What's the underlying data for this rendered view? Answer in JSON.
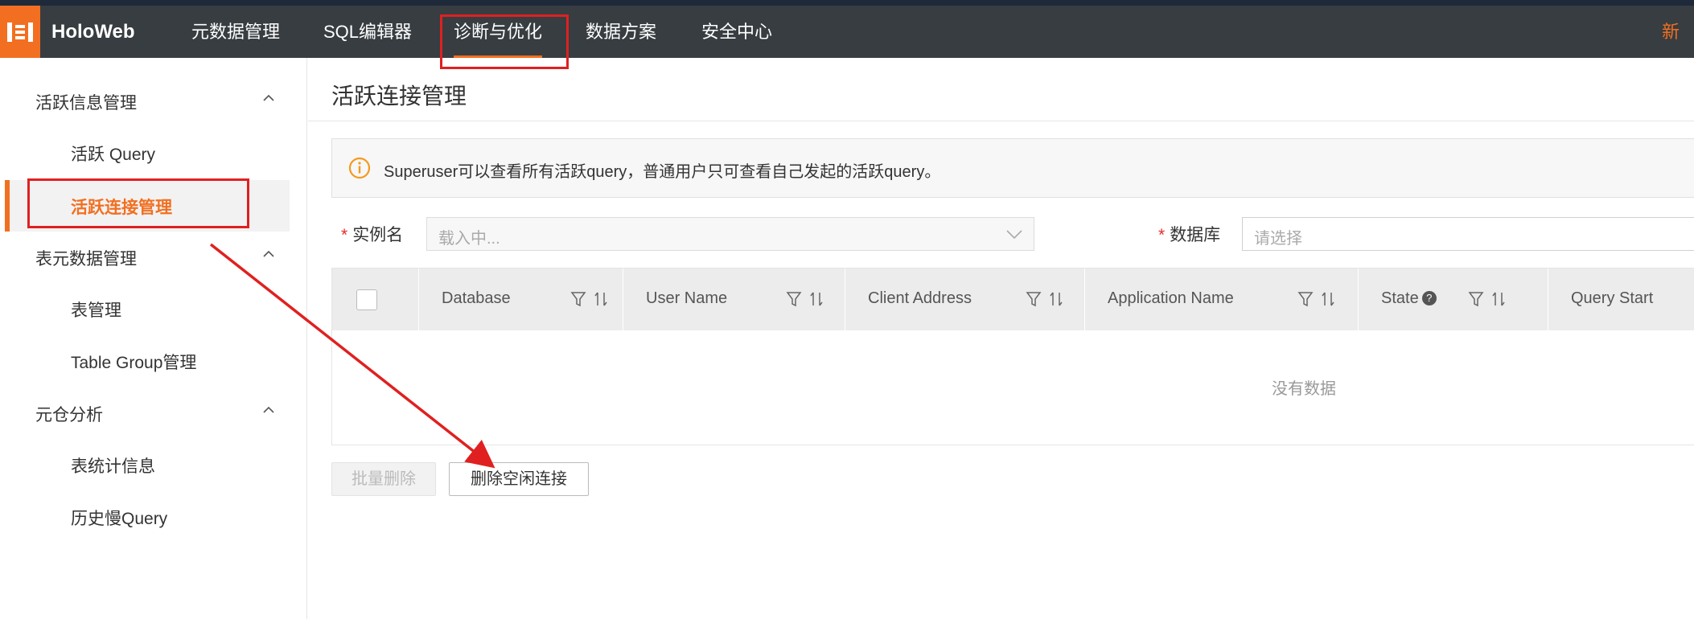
{
  "topbar": {
    "brand": "HoloWeb",
    "nav": [
      {
        "label": "元数据管理"
      },
      {
        "label": "SQL编辑器"
      },
      {
        "label": "诊断与优化"
      },
      {
        "label": "数据方案"
      },
      {
        "label": "安全中心"
      }
    ],
    "right_label": "新功"
  },
  "sidebar": {
    "groups": [
      {
        "label": "活跃信息管理",
        "items": [
          "活跃 Query",
          "活跃连接管理"
        ]
      },
      {
        "label": "表元数据管理",
        "items": [
          "表管理",
          "Table Group管理"
        ]
      },
      {
        "label": "元仓分析",
        "items": [
          "表统计信息",
          "历史慢Query"
        ]
      }
    ],
    "active_item": "活跃连接管理"
  },
  "main": {
    "title": "活跃连接管理",
    "notice": "Superuser可以查看所有活跃query，普通用户只可查看自己发起的活跃query。",
    "instance": {
      "label": "实例名",
      "required_mark": "*",
      "placeholder": "载入中..."
    },
    "database": {
      "label": "数据库",
      "required_mark": "*",
      "placeholder": "请选择"
    },
    "table": {
      "columns": [
        "Database",
        "User Name",
        "Client Address",
        "Application Name",
        "State",
        "Query Start"
      ],
      "empty_text": "没有数据"
    },
    "buttons": {
      "batch_delete": "批量删除",
      "delete_idle": "删除空闲连接"
    }
  },
  "colors": {
    "accent": "#f26f21",
    "topbar": "#373d41",
    "annotation": "#e02020"
  }
}
